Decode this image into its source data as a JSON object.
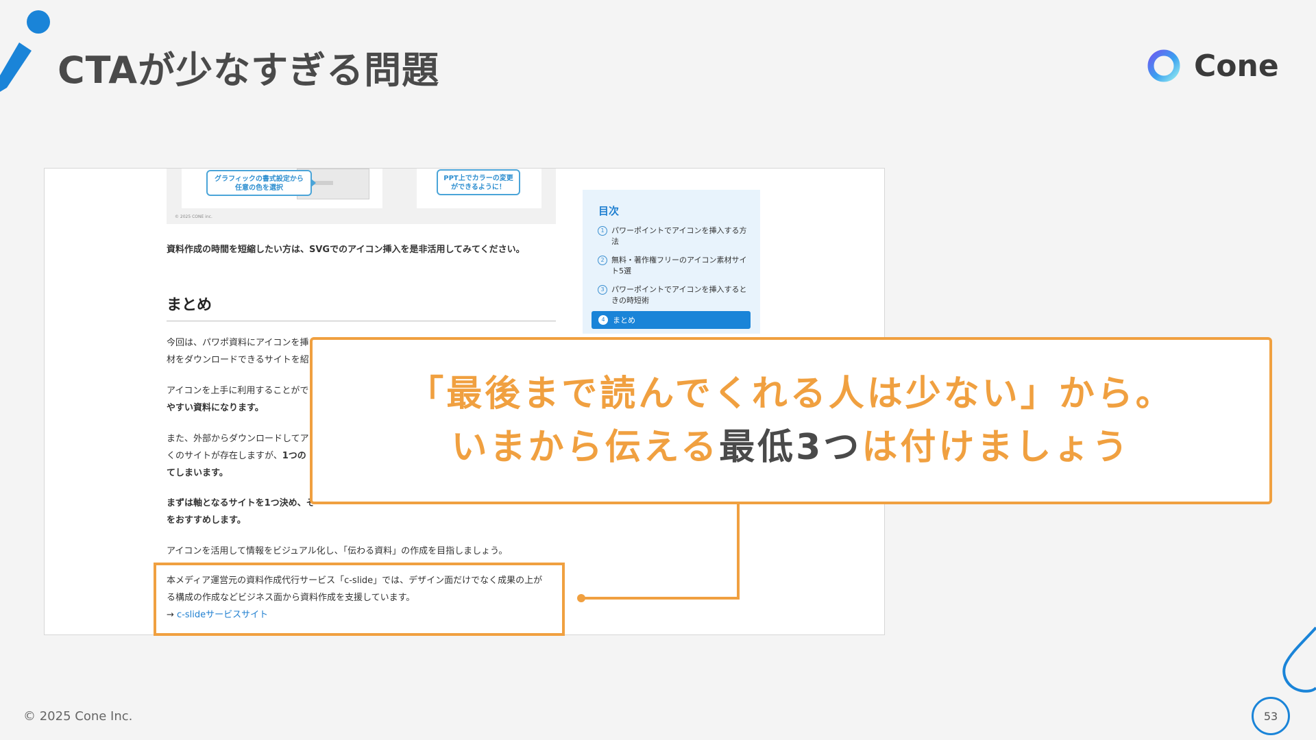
{
  "slide": {
    "title": "CTAが少なすぎる問題",
    "logo_text": "Cone",
    "footer": "© 2025 Cone Inc.",
    "page_number": "53",
    "colors": {
      "accent_orange": "#f0a040",
      "brand_blue": "#1a84d8",
      "title_gray": "#4a4a4a"
    }
  },
  "screenshot": {
    "graphic": {
      "callout_left": "グラフィックの書式設定から\n任意の色を選択",
      "callout_right": "PPT上でカラーの変更\nができるように！",
      "copyright": "© 2025 CONE inc."
    },
    "article": {
      "intro": "資料作成の時間を短縮したい方は、SVGでのアイコン挿入を是非活用してみてください。",
      "heading": "まとめ",
      "p1_line1": "今回は、パワポ資料にアイコンを挿",
      "p1_line2": "材をダウンロードできるサイトを紹",
      "p2_line1": "アイコンを上手に利用することがで",
      "p2_line2": "やすい資料になります。",
      "p3_line1": "また、外部からダウンロードしてア",
      "p3_line2_a": "くのサイトが存在しますが、",
      "p3_line2_b": "1つの",
      "p3_line3": "てしまいます。",
      "p4_line1": "まずは軸となるサイトを1つ決め、そ",
      "p4_line2": "をおすすめします。",
      "p5": "アイコンを活用して情報をビジュアル化し、「伝わる資料」の作成を目指しましょう。",
      "cta_line1": "本メディア運営元の資料作成代行サービス「c-slide」では、デザイン面だけでなく成果の上が",
      "cta_line2": "る構成の作成などビジネス面から資料作成を支援しています。",
      "cta_arrow": "→ ",
      "cta_link": "c-slideサービスサイト"
    },
    "toc": {
      "title": "目次",
      "items": [
        {
          "num": "1",
          "label": "パワーポイントでアイコンを挿入する方法"
        },
        {
          "num": "2",
          "label": "無料・著作権フリーのアイコン素材サイト5選"
        },
        {
          "num": "3",
          "label": "パワーポイントでアイコンを挿入するときの時短術"
        }
      ],
      "active": {
        "num": "4",
        "label": "まとめ"
      }
    }
  },
  "message": {
    "line1": "「最後まで読んでくれる人は少ない」から。",
    "line2_a": "いまから伝える",
    "line2_b": "最低3つ",
    "line2_c": "は付けましょう"
  }
}
